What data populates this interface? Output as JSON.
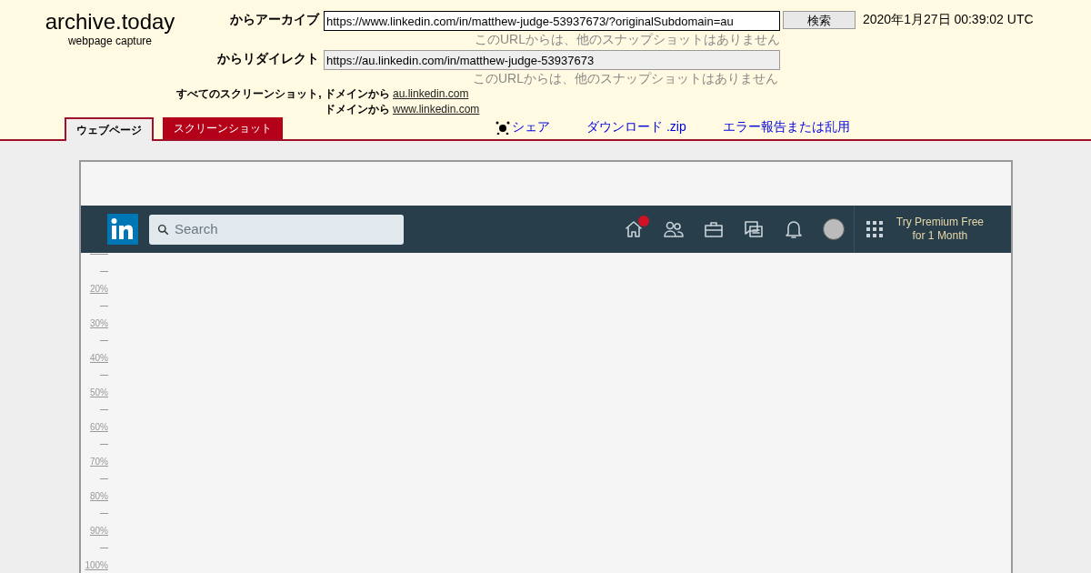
{
  "logo": {
    "title": "archive.today",
    "subtitle": "webpage capture"
  },
  "archive_row": {
    "label": "からアーカイブ",
    "value": "https://www.linkedin.com/in/matthew-judge-53937673/?originalSubdomain=au",
    "button": "検索",
    "date": "2020年1月27日 00:39:02 UTC",
    "note": "このURLからは、他のスナップショットはありません"
  },
  "redirect_row": {
    "label": "からリダイレクト",
    "value": "https://au.linkedin.com/in/matthew-judge-53937673",
    "note": "このURLからは、他のスナップショットはありません"
  },
  "domains": [
    {
      "prefix": "すべてのスクリーンショット, ドメインから",
      "link": "au.linkedin.com"
    },
    {
      "prefix": "ドメインから",
      "link": "www.linkedin.com"
    }
  ],
  "tabs": [
    {
      "label": "ウェブページ",
      "selected": true
    },
    {
      "label": "スクリーンショット",
      "selected": false
    }
  ],
  "actions": [
    {
      "label": "シェア",
      "kind": "share"
    },
    {
      "label": "ダウンロード .zip",
      "kind": "plain"
    },
    {
      "label": "エラー報告または乱用",
      "kind": "plain"
    }
  ],
  "capture": {
    "search_placeholder": "Search",
    "home_badge": true,
    "premium": [
      "Try Premium Free",
      "for 1 Month"
    ],
    "scale": [
      "20%",
      "30%",
      "40%",
      "50%",
      "60%",
      "70%",
      "80%",
      "90%",
      "100%"
    ]
  }
}
